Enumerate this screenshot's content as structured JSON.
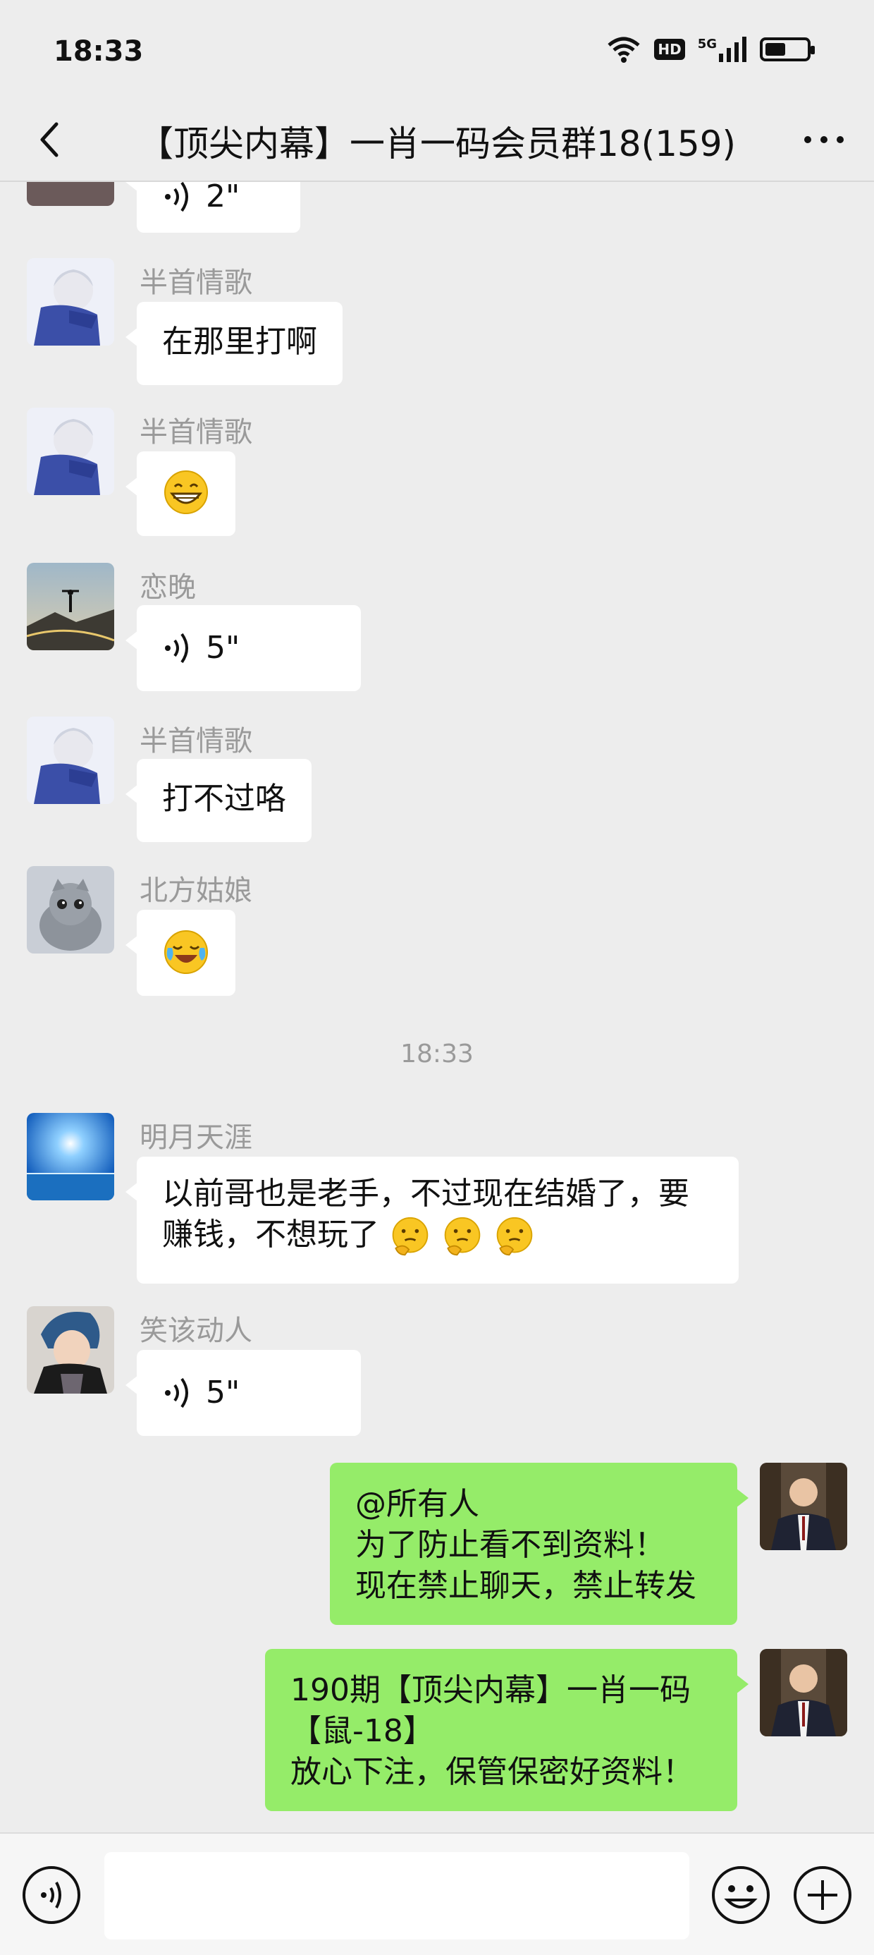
{
  "status_bar": {
    "time": "18:33",
    "hd_label": "HD",
    "network": "5G",
    "battery_level": 0.5
  },
  "header": {
    "title": "【顶尖内幕】一肖一码会员群18(159)"
  },
  "messages": [
    {
      "type": "voice",
      "duration": "2\""
    },
    {
      "sender": "半首情歌",
      "type": "text",
      "text": "在那里打啊"
    },
    {
      "sender": "半首情歌",
      "type": "emoji",
      "emoji": "grin-emoji"
    },
    {
      "sender": "恋晚",
      "type": "voice",
      "duration": "5\""
    },
    {
      "sender": "半首情歌",
      "type": "text",
      "text": "打不过咯"
    },
    {
      "sender": "北方姑娘",
      "type": "emoji",
      "emoji": "crying-laughing-emoji"
    },
    {
      "sender": "明月天涯",
      "type": "text",
      "line1": "以前哥也是老手，不过现在结婚了，要",
      "line2": "赚钱，不想玩了"
    },
    {
      "sender": "笑该动人",
      "type": "voice",
      "duration": "5\""
    },
    {
      "sender": "self",
      "type": "text",
      "line1": "@所有人",
      "line2": "为了防止看不到资料！",
      "line3": "现在禁止聊天，禁止转发"
    },
    {
      "sender": "self",
      "type": "text",
      "line1": "190期【顶尖内幕】一肖一码",
      "line2": "【鼠-18】",
      "line3": "放心下注，保管保密好资料！"
    }
  ],
  "time_separator": "18:33",
  "colors": {
    "background": "#ededed",
    "self_bubble": "#95ec69",
    "other_bubble": "#ffffff",
    "sender_name": "#9a9a9a"
  },
  "input_bar": {
    "placeholder": ""
  }
}
